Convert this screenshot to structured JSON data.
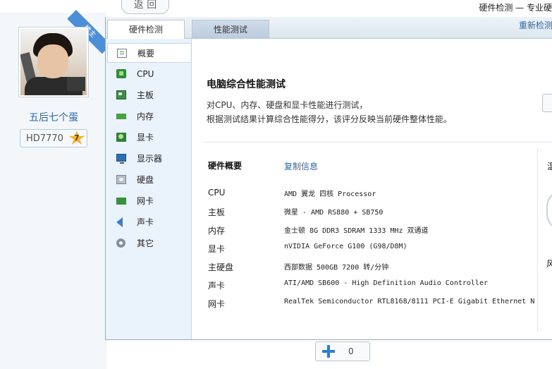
{
  "profile": {
    "ribbon_text": "楼主",
    "username": "五后七个蛋",
    "badge_gpu": "HD7770",
    "badge_level": "7"
  },
  "header": {
    "back_label": "返 回",
    "window_title": "硬件检测 — 专业硬"
  },
  "tabs": [
    {
      "label": "硬件检测",
      "active": true
    },
    {
      "label": "性能测试",
      "active": false
    }
  ],
  "retest_label": "重新检测",
  "nav": [
    {
      "label": "概要",
      "icon": "overview-icon"
    },
    {
      "label": "CPU",
      "icon": "cpu-icon"
    },
    {
      "label": "主板",
      "icon": "motherboard-icon"
    },
    {
      "label": "内存",
      "icon": "memory-icon"
    },
    {
      "label": "显卡",
      "icon": "graphics-card-icon"
    },
    {
      "label": "显示器",
      "icon": "monitor-icon"
    },
    {
      "label": "硬盘",
      "icon": "hard-disk-icon"
    },
    {
      "label": "网卡",
      "icon": "network-card-icon"
    },
    {
      "label": "声卡",
      "icon": "speaker-icon"
    },
    {
      "label": "其它",
      "icon": "gear-icon"
    }
  ],
  "content": {
    "heading": "电脑综合性能测试",
    "desc_line1": "对CPU、内存、硬盘和显卡性能进行测试，",
    "desc_line2": "根据测试结果计算综合性能得分，该评分反映当前硬件整体性能。",
    "section_title": "硬件概要",
    "copy_label": "复制信息",
    "rows": [
      {
        "key": "CPU",
        "value": "AMD 翼龙 四核 Processor"
      },
      {
        "key": "主板",
        "value": "微星 - AMD RS880 + SB750"
      },
      {
        "key": "内存",
        "value": "金士顿 8G DDR3 SDRAM 1333 MHz 双通道"
      },
      {
        "key": "显卡",
        "value": "nVIDIA GeForce G100 (G98/D8M)"
      },
      {
        "key": "主硬盘",
        "value": "西部数据 500GB 7200 转/分钟"
      },
      {
        "key": "声卡",
        "value": "ATI/AMD SB600 - High Definition Audio Controller"
      },
      {
        "key": "网卡",
        "value": "RealTek Semiconductor RTL8168/8111 PCI-E Gigabit Ethernet N"
      }
    ],
    "side_char1": "温",
    "side_char2": "风"
  },
  "bottom": {
    "count": "0"
  },
  "colors": {
    "link": "#2f68a8",
    "accent": "#4d8fd6",
    "nav_bg": "#eaf2fb"
  }
}
